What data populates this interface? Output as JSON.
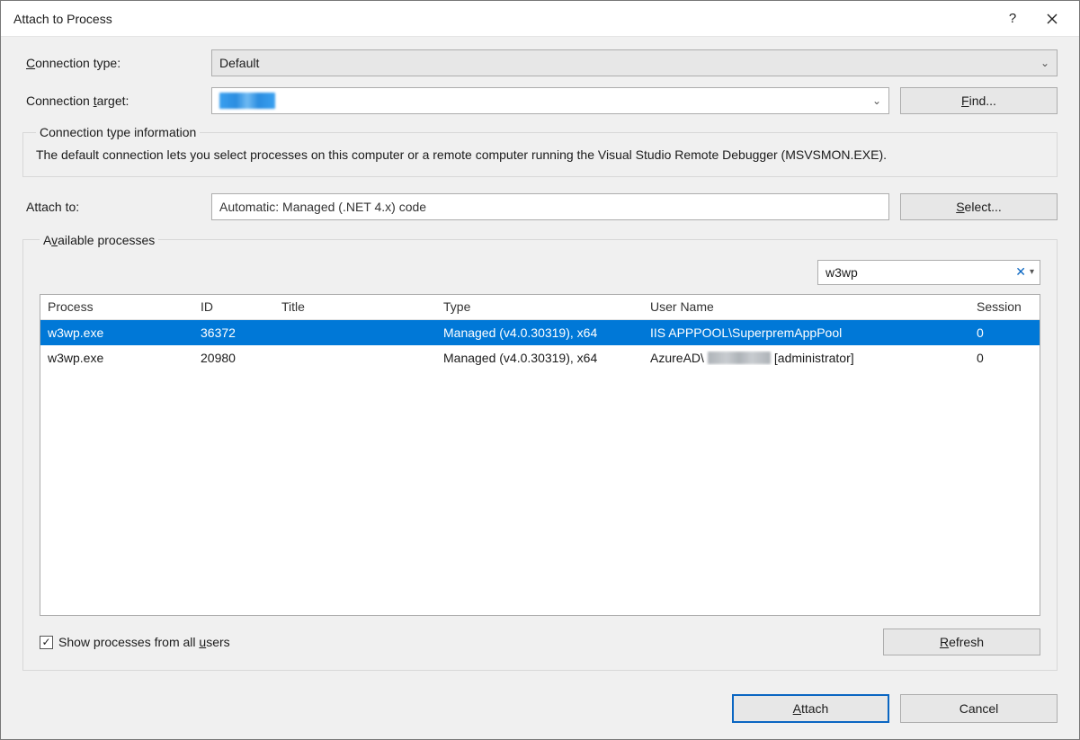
{
  "window": {
    "title": "Attach to Process"
  },
  "labels": {
    "connection_type": "Connection type:",
    "connection_type_ul": "C",
    "connection_target": "Connection target:",
    "connection_target_ul": "t",
    "attach_to": "Attach to:",
    "available_processes": "Available processes",
    "available_processes_ul": "v",
    "show_all": "Show processes from all users",
    "show_all_ul": "u"
  },
  "connection": {
    "type_value": "Default",
    "target_value_redacted": true,
    "find_label": "Find...",
    "find_ul": "F"
  },
  "groupbox": {
    "legend": "Connection type information",
    "text": "The default connection lets you select processes on this computer or a remote computer running the Visual Studio Remote Debugger (MSVSMON.EXE)."
  },
  "attach": {
    "value": "Automatic: Managed (.NET 4.x) code",
    "select_label": "Select...",
    "select_ul": "S"
  },
  "filter": {
    "value": "w3wp"
  },
  "columns": {
    "process": "Process",
    "id": "ID",
    "title": "Title",
    "type": "Type",
    "user": "User Name",
    "session": "Session"
  },
  "processes": [
    {
      "name": "w3wp.exe",
      "id": "36372",
      "title": "",
      "type": "Managed (v4.0.30319), x64",
      "user_prefix": "IIS APPPOOL\\SuperpremAppPool",
      "user_redacted": false,
      "user_suffix": "",
      "session": "0",
      "selected": true
    },
    {
      "name": "w3wp.exe",
      "id": "20980",
      "title": "",
      "type": "Managed (v4.0.30319), x64",
      "user_prefix": "AzureAD\\",
      "user_redacted": true,
      "user_suffix": "[administrator]",
      "session": "0",
      "selected": false
    }
  ],
  "buttons": {
    "refresh": "Refresh",
    "refresh_ul": "R",
    "attach": "Attach",
    "attach_ul": "A",
    "cancel": "Cancel"
  },
  "checkboxes": {
    "show_all_checked": true
  }
}
